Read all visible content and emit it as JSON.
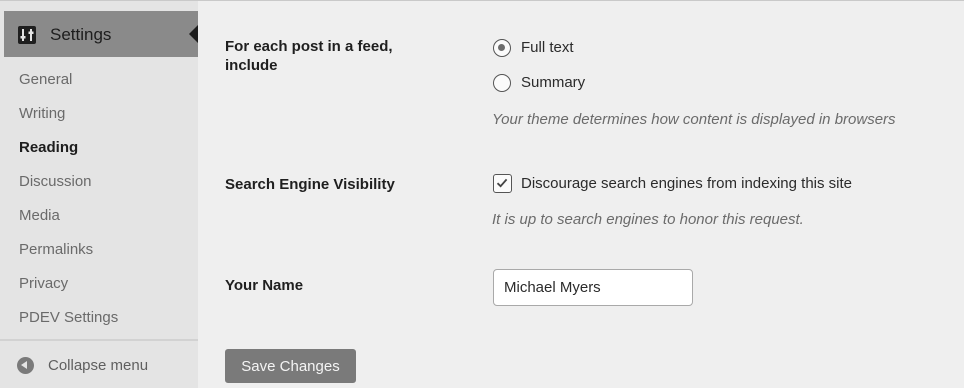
{
  "sidebar": {
    "header_label": "Settings",
    "items": [
      {
        "label": "General",
        "active": false
      },
      {
        "label": "Writing",
        "active": false
      },
      {
        "label": "Reading",
        "active": true
      },
      {
        "label": "Discussion",
        "active": false
      },
      {
        "label": "Media",
        "active": false
      },
      {
        "label": "Permalinks",
        "active": false
      },
      {
        "label": "Privacy",
        "active": false
      },
      {
        "label": "PDEV Settings",
        "active": false
      }
    ],
    "collapse_label": "Collapse menu"
  },
  "feed": {
    "label_line1": "For each post in a feed,",
    "label_line2": "include",
    "options": [
      {
        "label": "Full text",
        "checked": true
      },
      {
        "label": "Summary",
        "checked": false
      }
    ],
    "help": "Your theme determines how content is displayed in browsers"
  },
  "search_visibility": {
    "label": "Search Engine Visibility",
    "checkbox_label": "Discourage search engines from indexing this site",
    "checked": true,
    "help": "It is up to search engines to honor this request."
  },
  "your_name": {
    "label": "Your Name",
    "value": "Michael Myers"
  },
  "save_label": "Save Changes"
}
